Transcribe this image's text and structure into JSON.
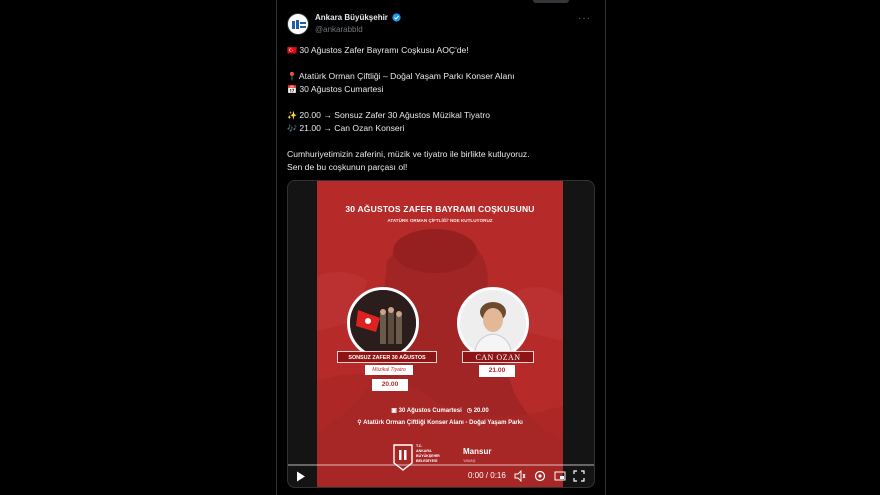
{
  "tweet": {
    "author_name": "Ankara Büyükşehir",
    "handle": "@ankarabbld",
    "more_label": "···",
    "lines": [
      {
        "emoji": "🇹🇷",
        "text": "30 Ağustos Zafer Bayramı Coşkusu AOÇ'de!"
      },
      {
        "emoji": "📍",
        "text": "Atatürk Orman Çiftliği – Doğal Yaşam Parkı Konser Alanı"
      },
      {
        "emoji": "📅",
        "text": "30 Ağustos Cumartesi"
      },
      {
        "emoji": "✨",
        "text": "20.00 → Sonsuz Zafer 30 Ağustos Müzikal Tiyatro"
      },
      {
        "emoji": "🎶",
        "text": "21.00 → Can Ozan Konseri"
      },
      {
        "emoji": "",
        "text": "Cumhuriyetimizin zaferini, müzik ve tiyatro ile birlikte kutluyoruz."
      },
      {
        "emoji": "",
        "text": "Sen de bu coşkunun parçası ol!"
      }
    ]
  },
  "poster": {
    "title": "30 AĞUSTOS ZAFER BAYRAMI COŞKUSUNU",
    "subtitle": "ATATÜRK ORMAN ÇİFTLİĞİ' NDE KUTLUYORUZ",
    "left_ribbon": "SONSUZ ZAFER 30 AĞUSTOS",
    "left_tag": "Müzikal Tiyatro",
    "left_time": "20.00",
    "right_ribbon": "CAN OZAN",
    "right_time": "21.00",
    "info_date": "30 Ağustos Cumartesi",
    "info_time": "20.00",
    "info_place": "Atatürk Orman Çiftliği Konser Alanı - Doğal Yaşam Parkı",
    "logo_text_1": "T.C.",
    "logo_text_2": "ANKARA",
    "logo_text_3": "BÜYÜKŞEHİR",
    "logo_text_4": "BELEDİYESİ",
    "logo2_text": "Mansur",
    "logo2_sub": "YAVAŞ",
    "accent": "#b72a2a"
  },
  "video": {
    "time_display": "0:00 / 0:16",
    "progress": 0
  }
}
